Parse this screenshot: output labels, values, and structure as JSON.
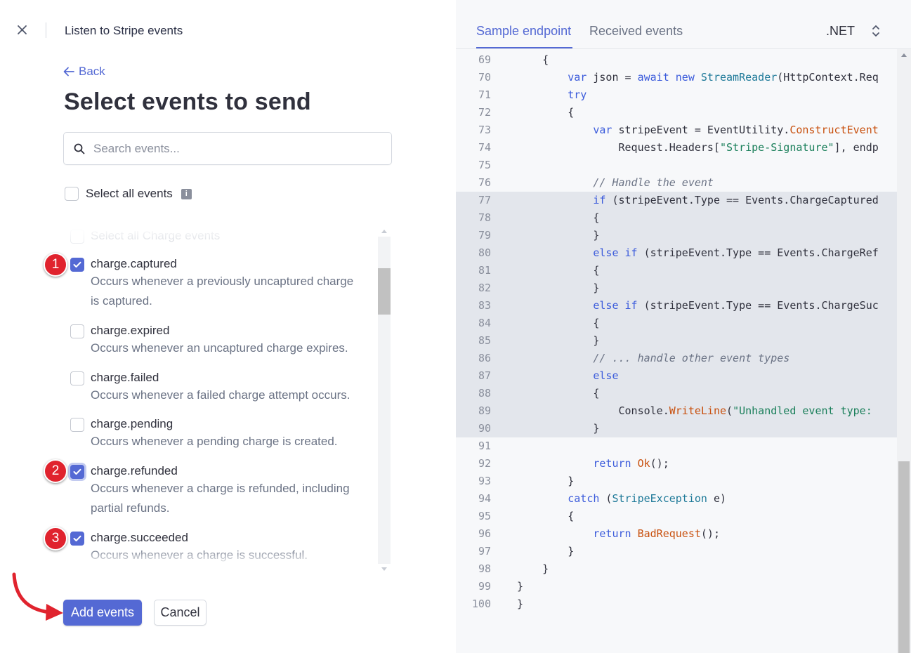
{
  "modal": {
    "title": "Listen to Stripe events",
    "back_label": "Back",
    "heading": "Select events to send"
  },
  "search": {
    "placeholder": "Search events..."
  },
  "select_all": {
    "label": "Select all events"
  },
  "group_header": "Select all Charge events",
  "events": [
    {
      "name": "charge.captured",
      "desc": "Occurs whenever a previously uncaptured charge is captured.",
      "checked": true
    },
    {
      "name": "charge.expired",
      "desc": "Occurs whenever an uncaptured charge expires.",
      "checked": false
    },
    {
      "name": "charge.failed",
      "desc": "Occurs whenever a failed charge attempt occurs.",
      "checked": false
    },
    {
      "name": "charge.pending",
      "desc": "Occurs whenever a pending charge is created.",
      "checked": false
    },
    {
      "name": "charge.refunded",
      "desc": "Occurs whenever a charge is refunded, including partial refunds.",
      "checked": true
    },
    {
      "name": "charge.succeeded",
      "desc": "Occurs whenever a charge is successful.",
      "checked": true
    }
  ],
  "annotations": [
    "1",
    "2",
    "3"
  ],
  "buttons": {
    "add": "Add events",
    "cancel": "Cancel"
  },
  "code_panel": {
    "tabs": [
      "Sample endpoint",
      "Received events"
    ],
    "active_tab": 0,
    "language": ".NET"
  },
  "code_lines": [
    {
      "n": "69",
      "text": "        {"
    },
    {
      "n": "70",
      "text": "            var json = await new StreamReader(HttpContext.Req"
    },
    {
      "n": "71",
      "text": "            try"
    },
    {
      "n": "72",
      "text": "            {"
    },
    {
      "n": "73",
      "text": "                var stripeEvent = EventUtility.ConstructEvent"
    },
    {
      "n": "74",
      "text": "                    Request.Headers[\"Stripe-Signature\"], endp"
    },
    {
      "n": "75",
      "text": ""
    },
    {
      "n": "76",
      "text": "                // Handle the event"
    },
    {
      "n": "77",
      "text": "                if (stripeEvent.Type == Events.ChargeCaptured"
    },
    {
      "n": "78",
      "text": "                {"
    },
    {
      "n": "79",
      "text": "                }"
    },
    {
      "n": "80",
      "text": "                else if (stripeEvent.Type == Events.ChargeRef"
    },
    {
      "n": "81",
      "text": "                {"
    },
    {
      "n": "82",
      "text": "                }"
    },
    {
      "n": "83",
      "text": "                else if (stripeEvent.Type == Events.ChargeSuc"
    },
    {
      "n": "84",
      "text": "                {"
    },
    {
      "n": "85",
      "text": "                }"
    },
    {
      "n": "86",
      "text": "                // ... handle other event types"
    },
    {
      "n": "87",
      "text": "                else"
    },
    {
      "n": "88",
      "text": "                {"
    },
    {
      "n": "89",
      "text": "                    Console.WriteLine(\"Unhandled event type: "
    },
    {
      "n": "90",
      "text": "                }"
    },
    {
      "n": "91",
      "text": ""
    },
    {
      "n": "92",
      "text": "                return Ok();"
    },
    {
      "n": "93",
      "text": "            }"
    },
    {
      "n": "94",
      "text": "            catch (StripeException e)"
    },
    {
      "n": "95",
      "text": "            {"
    },
    {
      "n": "96",
      "text": "                return BadRequest();"
    },
    {
      "n": "97",
      "text": "            }"
    },
    {
      "n": "98",
      "text": "        }"
    },
    {
      "n": "99",
      "text": "    }"
    },
    {
      "n": "100",
      "text": "}"
    }
  ],
  "highlighted_lines": [
    "77",
    "78",
    "79",
    "80",
    "81",
    "82",
    "83",
    "84",
    "85",
    "86",
    "87",
    "88",
    "89",
    "90"
  ],
  "colors": {
    "accent": "#5469d4",
    "annotation_red": "#e0232e",
    "highlight": "#e3e6ec"
  },
  "icons": {
    "close": "close-icon",
    "back": "arrow-left-icon",
    "search": "search-icon",
    "info": "info-icon",
    "check": "check-icon",
    "lang_toggle": "chevron-updown-icon"
  }
}
